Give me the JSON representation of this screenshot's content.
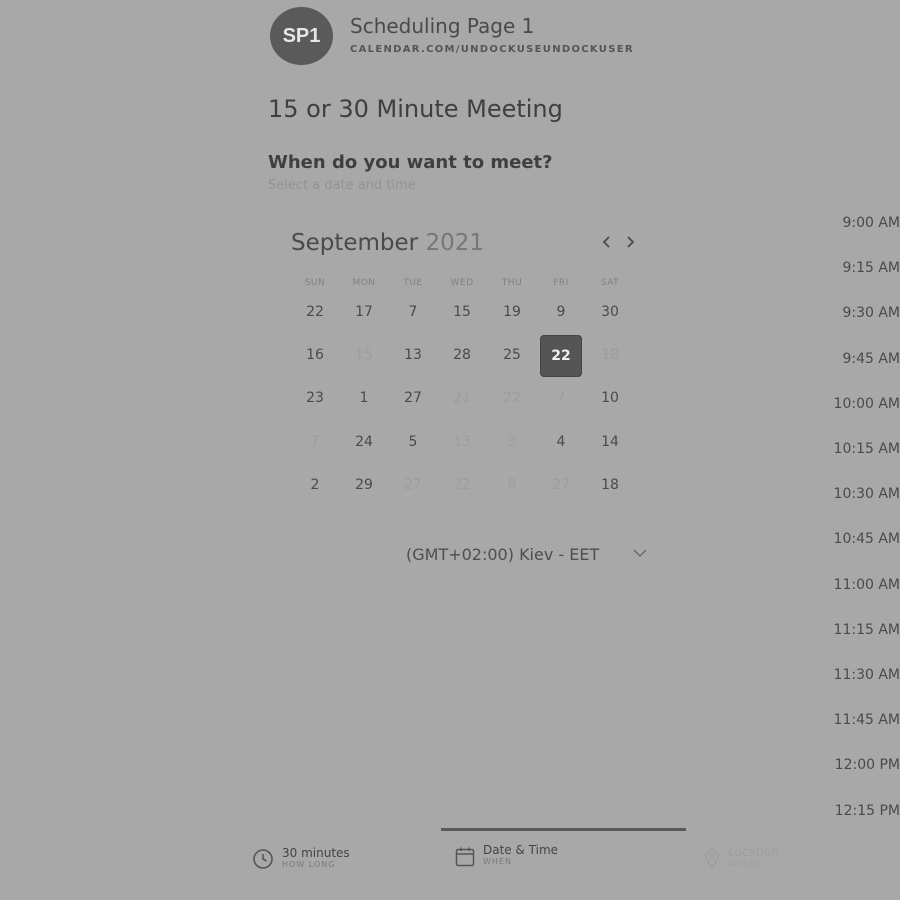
{
  "header": {
    "avatar_initials": "SP1",
    "page_title": "Scheduling Page 1",
    "page_url": "CALENDAR.COM/UNDOCKUSEUNDOCKUSER"
  },
  "meeting": {
    "title": "15 or 30 Minute Meeting",
    "question": "When do you want to meet?",
    "instruction": "Select a date and time"
  },
  "calendar": {
    "month": "September",
    "year": "2021",
    "weekdays": [
      "SUN",
      "MON",
      "TUE",
      "WED",
      "THU",
      "FRI",
      "SAT"
    ],
    "weeks": [
      [
        {
          "d": "22"
        },
        {
          "d": "17"
        },
        {
          "d": "7"
        },
        {
          "d": "15"
        },
        {
          "d": "19"
        },
        {
          "d": "9"
        },
        {
          "d": "30"
        }
      ],
      [
        {
          "d": "16"
        },
        {
          "d": "15",
          "disabled": true
        },
        {
          "d": "13"
        },
        {
          "d": "28"
        },
        {
          "d": "25"
        },
        {
          "d": "22",
          "selected": true
        },
        {
          "d": "18",
          "disabled": true
        }
      ],
      [
        {
          "d": "23"
        },
        {
          "d": "1"
        },
        {
          "d": "27"
        },
        {
          "d": "21",
          "disabled": true
        },
        {
          "d": "22",
          "disabled": true
        },
        {
          "d": "7",
          "disabled": true
        },
        {
          "d": "10"
        }
      ],
      [
        {
          "d": "7",
          "disabled": true
        },
        {
          "d": "24"
        },
        {
          "d": "5"
        },
        {
          "d": "13",
          "disabled": true
        },
        {
          "d": "3",
          "disabled": true
        },
        {
          "d": "4"
        },
        {
          "d": "14"
        }
      ],
      [
        {
          "d": "2"
        },
        {
          "d": "29"
        },
        {
          "d": "27",
          "disabled": true
        },
        {
          "d": "22",
          "disabled": true
        },
        {
          "d": "8",
          "disabled": true
        },
        {
          "d": "27",
          "disabled": true
        },
        {
          "d": "18"
        }
      ]
    ]
  },
  "timezone": {
    "value": "(GMT+02:00) Kiev - EET"
  },
  "times": [
    "9:00 AM",
    "9:15 AM",
    "9:30 AM",
    "9:45 AM",
    "10:00 AM",
    "10:15 AM",
    "10:30 AM",
    "10:45 AM",
    "11:00 AM",
    "11:15 AM",
    "11:30 AM",
    "11:45 AM",
    "12:00 PM",
    "12:15 PM"
  ],
  "steps": [
    {
      "label": "30 minutes",
      "sub": "HOW LONG",
      "icon": "clock-icon"
    },
    {
      "label": "Date & Time",
      "sub": "WHEN",
      "icon": "calendar-icon"
    },
    {
      "label": "Location",
      "sub": "WHERE",
      "icon": "location-pin-icon"
    }
  ]
}
